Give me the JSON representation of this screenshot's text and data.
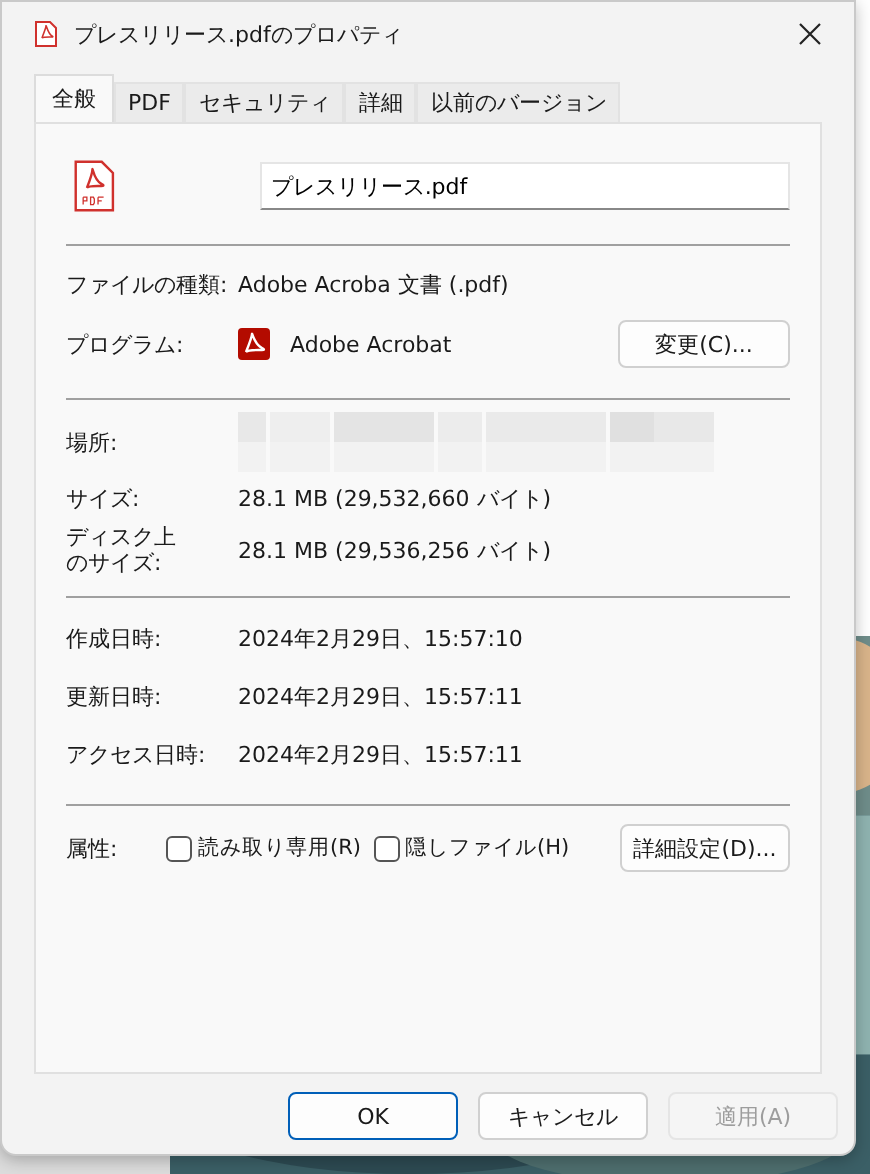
{
  "window": {
    "title": "プレスリリース.pdfのプロパティ"
  },
  "tabs": [
    {
      "label": "全般",
      "selected": true
    },
    {
      "label": "PDF",
      "selected": false
    },
    {
      "label": "セキュリティ",
      "selected": false
    },
    {
      "label": "詳細",
      "selected": false
    },
    {
      "label": "以前のバージョン",
      "selected": false
    }
  ],
  "file_name": {
    "value": "プレスリリース.pdf"
  },
  "type_row": {
    "label": "ファイルの種類:",
    "value": "Adobe Acroba 文書 (.pdf)"
  },
  "program_row": {
    "label": "プログラム:",
    "value": "Adobe Acrobat",
    "button": "変更(C)..."
  },
  "location_row": {
    "label": "場所:"
  },
  "size_rows": [
    {
      "label": "サイズ:",
      "value": "28.1 MB (29,532,660 バイト)"
    },
    {
      "label": "ディスク上のサイズ:",
      "value": "28.1 MB (29,536,256 バイト)"
    }
  ],
  "date_rows": [
    {
      "label": "作成日時:",
      "value": "2024年2月29日、15:57:10"
    },
    {
      "label": "更新日時:",
      "value": "2024年2月29日、15:57:11"
    },
    {
      "label": "アクセス日時:",
      "value": "2024年2月29日、15:57:11"
    }
  ],
  "attributes": {
    "label": "属性:",
    "checkboxes": [
      {
        "label": "読み取り専用(R)",
        "checked": false
      },
      {
        "label": "隠しファイル(H)",
        "checked": false
      }
    ],
    "button": "詳細設定(D)..."
  },
  "buttons": [
    {
      "label": "OK",
      "kind": "default",
      "disabled": false
    },
    {
      "label": "キャンセル",
      "kind": "normal",
      "disabled": false
    },
    {
      "label": "適用(A)",
      "kind": "normal",
      "disabled": true
    }
  ]
}
